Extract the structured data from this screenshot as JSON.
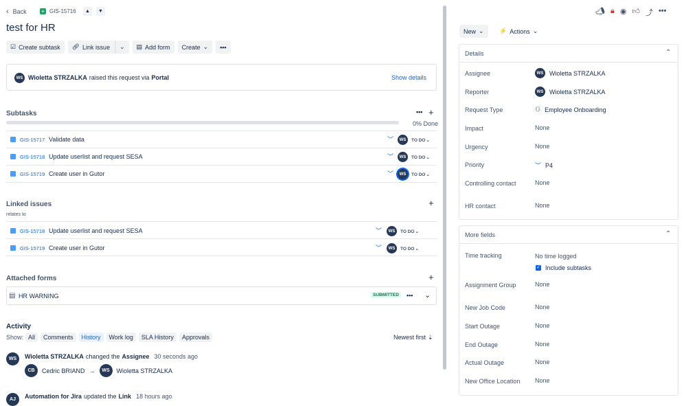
{
  "header": {
    "back_label": "Back",
    "issue_key": "GIS-15716",
    "title": "test for HR"
  },
  "toolbar": {
    "create_subtask": "Create subtask",
    "link_issue": "Link issue",
    "add_form": "Add form",
    "create": "Create"
  },
  "request_info": {
    "avatar": "WS",
    "user": "Wioletta STRZALKA",
    "text": "raised this request via",
    "channel": "Portal",
    "show_details": "Show details"
  },
  "subtasks": {
    "title": "Subtasks",
    "progress": 0,
    "progress_label": "0% Done",
    "items": [
      {
        "key": "GIS-15717",
        "summary": "Validate data",
        "assignee": "WS",
        "status": "TO DO"
      },
      {
        "key": "GIS-15718",
        "summary": "Update userlist and request SESA",
        "assignee": "WS",
        "status": "TO DO"
      },
      {
        "key": "GIS-15719",
        "summary": "Create user in Gutor",
        "assignee": "WS",
        "status": "TO DO"
      }
    ]
  },
  "linked": {
    "title": "Linked issues",
    "relation": "relates to",
    "items": [
      {
        "key": "GIS-15718",
        "summary": "Update userlist and request SESA",
        "assignee": "WS",
        "status": "TO DO"
      },
      {
        "key": "GIS-15719",
        "summary": "Create user in Gutor",
        "assignee": "WS",
        "status": "TO DO"
      }
    ]
  },
  "forms": {
    "title": "Attached forms",
    "form_name": "HR WARNING",
    "form_status": "SUBMITTED"
  },
  "activity": {
    "title": "Activity",
    "show_label": "Show:",
    "tabs": [
      "All",
      "Comments",
      "History",
      "Work log",
      "SLA History",
      "Approvals"
    ],
    "active_tab": "History",
    "sort_label": "Newest first",
    "entries": [
      {
        "avatar": "WS",
        "user": "Wioletta STRZALKA",
        "action": "changed the",
        "field": "Assignee",
        "time": "30 seconds ago",
        "from_avatar": "CB",
        "from": "Cedric BRIAND",
        "arrow": "→",
        "to_avatar": "WS",
        "to": "Wioletta STRZALKA"
      },
      {
        "avatar": "AJ",
        "user": "Automation for Jira",
        "action": "updated the",
        "field": "Link",
        "time": "18 hours ago"
      }
    ]
  },
  "right": {
    "status_button": "New",
    "actions_button": "Actions",
    "details": {
      "title": "Details",
      "fields": [
        {
          "label": "Assignee",
          "value": "Wioletta STRZALKA",
          "avatar": "WS"
        },
        {
          "label": "Reporter",
          "value": "Wioletta STRZALKA",
          "avatar": "WS"
        },
        {
          "label": "Request Type",
          "value": "Employee Onboarding"
        },
        {
          "label": "Impact",
          "value": "None"
        },
        {
          "label": "Urgency",
          "value": "None"
        },
        {
          "label": "Priority",
          "value": "P4"
        },
        {
          "label": "Controlling contact",
          "value": "None"
        },
        {
          "label": "HR contact",
          "value": "None"
        }
      ]
    },
    "more": {
      "title": "More fields",
      "time_tracking_label": "Time tracking",
      "time_tracking_value": "No time logged",
      "include_subtasks": "Include subtasks",
      "include_subtasks_checked": true,
      "fields": [
        {
          "label": "Assignment Group",
          "value": "None"
        },
        {
          "label": "New Job Code",
          "value": "None"
        },
        {
          "label": "Start Outage",
          "value": "None"
        },
        {
          "label": "End Outage",
          "value": "None"
        },
        {
          "label": "Actual Outage",
          "value": "None"
        },
        {
          "label": "New Office Location",
          "value": "None"
        }
      ]
    }
  },
  "colors": {
    "link": "#0c66e4",
    "avatar": "#253858",
    "submitted": "#216e4e",
    "lock": "#c9372c"
  }
}
